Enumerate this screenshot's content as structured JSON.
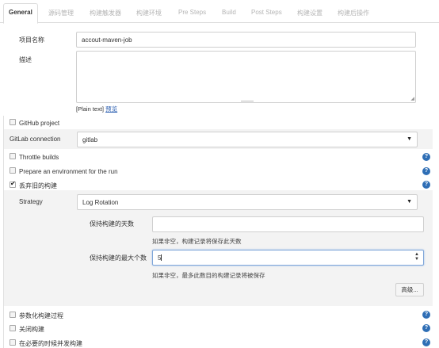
{
  "tabs": [
    {
      "label": "General",
      "active": true
    },
    {
      "label": "源码管理"
    },
    {
      "label": "构建触发器"
    },
    {
      "label": "构建环境"
    },
    {
      "label": "Pre Steps"
    },
    {
      "label": "Build"
    },
    {
      "label": "Post Steps"
    },
    {
      "label": "构建设置"
    },
    {
      "label": "构建后操作"
    }
  ],
  "general": {
    "project_name_label": "项目名称",
    "project_name_value": "accout-maven-job",
    "description_label": "描述",
    "description_value": "",
    "plain_text": "[Plain text]",
    "preview_link": "预览"
  },
  "options": {
    "github_project": "GitHub project",
    "gitlab_connection_label": "GitLab connection",
    "gitlab_connection_value": "gitlab",
    "throttle_builds": "Throttle builds",
    "prepare_env": "Prepare an environment for the run",
    "discard_old_builds": "丢弃旧的构建",
    "parameterized": "参数化构建过程",
    "disable_build": "关闭构建",
    "concurrent": "在必要的时候并发构建"
  },
  "discard": {
    "strategy_label": "Strategy",
    "strategy_value": "Log Rotation",
    "days_label": "保持构建的天数",
    "days_value": "",
    "days_hint": "如果非空，构建记录将保存此天数",
    "max_label": "保持构建的最大个数",
    "max_value": "5",
    "max_hint": "如果非空，最多此数目的构建记录将被保存",
    "advanced_button": "高级..."
  },
  "icons": {
    "help": "?",
    "caret": "▼",
    "stepper_up": "▲",
    "stepper_down": "▼"
  },
  "colors": {
    "help_icon": "#2e6eb5",
    "link": "#2a5db0",
    "focus_border": "#7fa6d9"
  }
}
